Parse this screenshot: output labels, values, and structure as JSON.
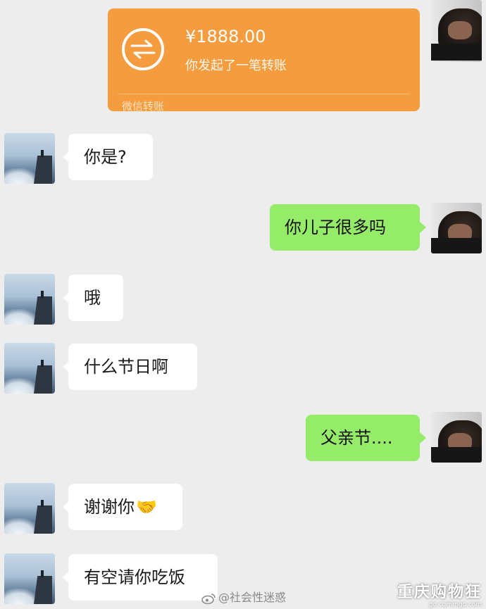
{
  "transfer": {
    "amount": "¥1888.00",
    "description": "你发起了一笔转账",
    "footer": "微信转账",
    "color": "#f49c3e"
  },
  "messages": [
    {
      "side": "in",
      "text": "你是?"
    },
    {
      "side": "out",
      "text": "你儿子很多吗"
    },
    {
      "side": "in",
      "text": "哦"
    },
    {
      "side": "in",
      "text": "什么节日啊"
    },
    {
      "side": "out",
      "text": "父亲节...."
    },
    {
      "side": "in",
      "text": "谢谢你",
      "emoji": "🤝"
    },
    {
      "side": "in",
      "text": "有空请你吃饭"
    }
  ],
  "colors": {
    "background": "#ededed",
    "incoming_bubble": "#ffffff",
    "outgoing_bubble": "#95ec69"
  },
  "watermarks": {
    "weibo": "@社会性迷惑",
    "site_name": "重庆购物狂",
    "site_url": "go.cqmmgo.com"
  }
}
